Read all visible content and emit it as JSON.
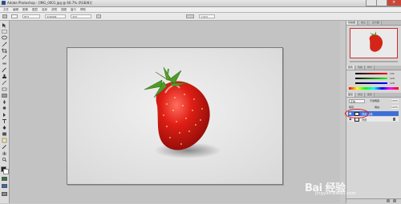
{
  "window": {
    "title": "Adobe Photoshop  - [IMG_0001.jpg @ 66.7% (RGB/8)]"
  },
  "menu": [
    "文件",
    "编辑",
    "图像",
    "图层",
    "选择",
    "滤镜",
    "视图",
    "窗口",
    "帮助"
  ],
  "options_bar": {
    "mode_label": "模式",
    "opacity_label": "不透明度",
    "flow_label": "流量",
    "workspace_label": "工作区"
  },
  "panels": {
    "navigator_tabs": [
      "导航器",
      "信息",
      "直方图"
    ],
    "color_tabs": [
      "颜色",
      "色板",
      "样式"
    ],
    "color_values": [
      "131",
      "129",
      "128"
    ],
    "layers_tabs": [
      "图层",
      "通道",
      "路径"
    ],
    "layers": {
      "blend_mode": "正常",
      "opacity_label": "不透明度:",
      "opacity_value": "100%",
      "fill_label": "填充:",
      "fill_value": "100%",
      "lock_label": "锁定:",
      "items": [
        {
          "name": "背景 副本",
          "selected": true
        },
        {
          "name": "背景",
          "selected": false
        }
      ]
    }
  },
  "colors": {
    "accent": "#3d6fd6",
    "highlight_circle": "#e01818"
  },
  "watermark": {
    "main": "Bai 经验",
    "sub": "jingyan.baidu.com"
  }
}
